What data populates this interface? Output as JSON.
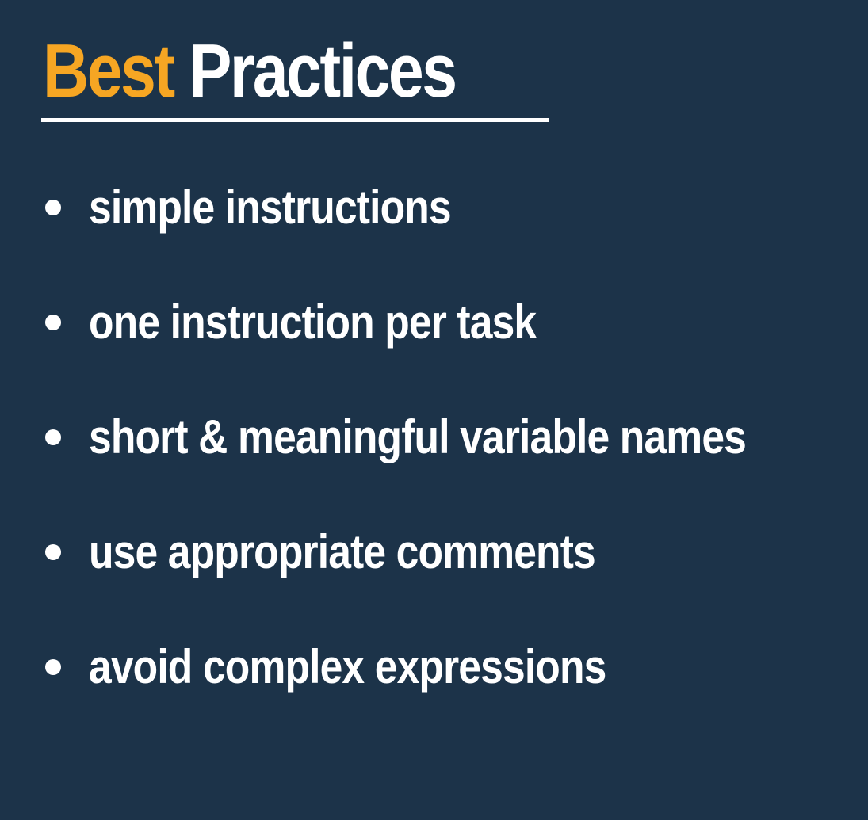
{
  "title": {
    "accent": "Best",
    "main": "Practices"
  },
  "bullets": [
    {
      "text": "simple instructions"
    },
    {
      "text": "one instruction per task"
    },
    {
      "text": "short & meaningful variable names"
    },
    {
      "text": "use appropriate comments"
    },
    {
      "text": "avoid complex expressions"
    }
  ],
  "colors": {
    "background": "#1c3349",
    "accent": "#f6a623",
    "text": "#ffffff"
  }
}
